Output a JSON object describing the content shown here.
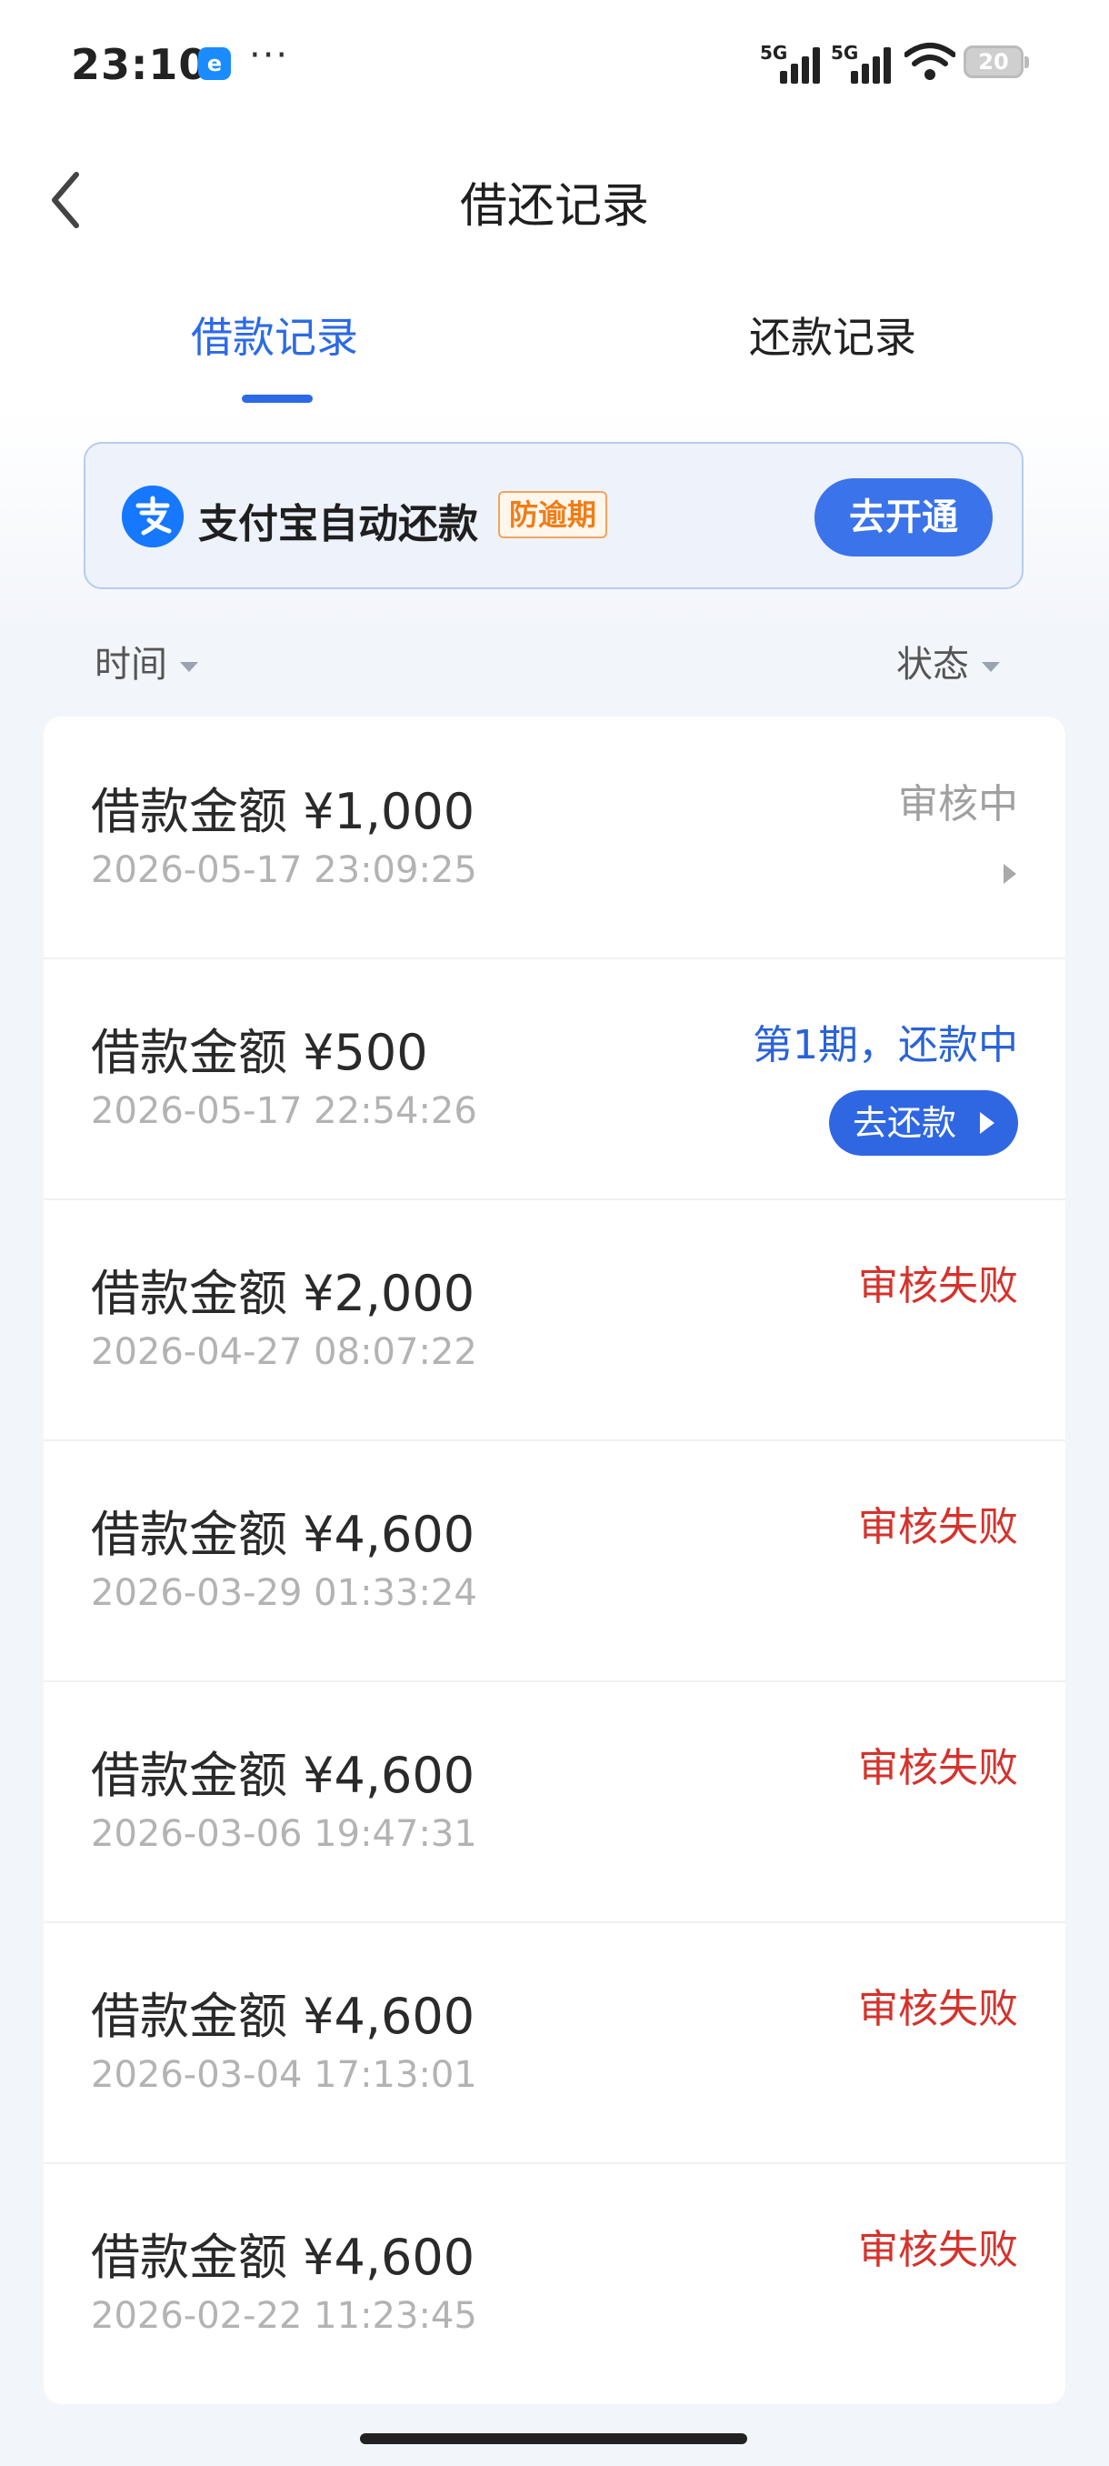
{
  "status_bar": {
    "time": "23:10",
    "app_badge": "e",
    "more": "···",
    "signal1_label": "5G",
    "signal2_label": "5G",
    "battery": "20"
  },
  "nav": {
    "title": "借还记录"
  },
  "tabs": [
    {
      "label": "借款记录",
      "active": true
    },
    {
      "label": "还款记录",
      "active": false
    }
  ],
  "banner": {
    "title": "支付宝自动还款",
    "badge": "防逾期",
    "button": "去开通"
  },
  "filters": {
    "time": "时间",
    "status": "状态"
  },
  "records": [
    {
      "amount": "借款金额 ¥1,000",
      "datetime": "2026-05-17 23:09:25",
      "status": "审核中",
      "status_type": "gray"
    },
    {
      "amount": "借款金额 ¥500",
      "datetime": "2026-05-17 22:54:26",
      "status": "第1期，还款中",
      "status_type": "blue",
      "action": "去还款"
    },
    {
      "amount": "借款金额 ¥2,000",
      "datetime": "2026-04-27 08:07:22",
      "status": "审核失败",
      "status_type": "red"
    },
    {
      "amount": "借款金额 ¥4,600",
      "datetime": "2026-03-29 01:33:24",
      "status": "审核失败",
      "status_type": "red"
    },
    {
      "amount": "借款金额 ¥4,600",
      "datetime": "2026-03-06 19:47:31",
      "status": "审核失败",
      "status_type": "red"
    },
    {
      "amount": "借款金额 ¥4,600",
      "datetime": "2026-03-04 17:13:01",
      "status": "审核失败",
      "status_type": "red"
    },
    {
      "amount": "借款金额 ¥4,600",
      "datetime": "2026-02-22 11:23:45",
      "status": "审核失败",
      "status_type": "red"
    }
  ],
  "colors": {
    "accent": "#2c6ae6",
    "fail": "#d5322c",
    "pending": "#a0a0a0"
  }
}
